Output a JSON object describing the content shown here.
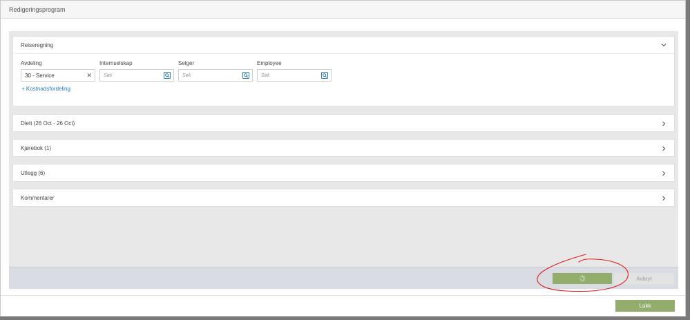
{
  "modal": {
    "title": "Redigeringsprogram"
  },
  "sections": {
    "reiseregning": {
      "title": "Reiseregning",
      "fields": {
        "avdeling": {
          "label": "Avdeling",
          "value": "30 - Service"
        },
        "internselskap": {
          "label": "Internselskap",
          "placeholder": "Søk"
        },
        "selger": {
          "label": "Selger",
          "placeholder": "Søk"
        },
        "employee": {
          "label": "Employee",
          "placeholder": "Søk"
        }
      },
      "add_link": "+ Kostnadsfordeling"
    },
    "diett": {
      "title": "Diett (26 Oct - 26 Oct)"
    },
    "kjorebok": {
      "title": "Kjørebok (1)"
    },
    "utlegg": {
      "title": "Utlegg (6)"
    },
    "kommentarer": {
      "title": "Kommentarer"
    }
  },
  "footer": {
    "cancel_label": "Avbryt"
  },
  "modal_footer": {
    "close_label": "Lukk"
  },
  "colors": {
    "accent": "#93ad6c",
    "link": "#2e7bbf",
    "annotation": "#e01b1b"
  },
  "icons": {
    "expanded": "chevron-down-icon",
    "collapsed": "chevron-right-icon",
    "lookup": "lookup-icon",
    "clear": "clear-icon",
    "loading": "spinner-icon"
  }
}
